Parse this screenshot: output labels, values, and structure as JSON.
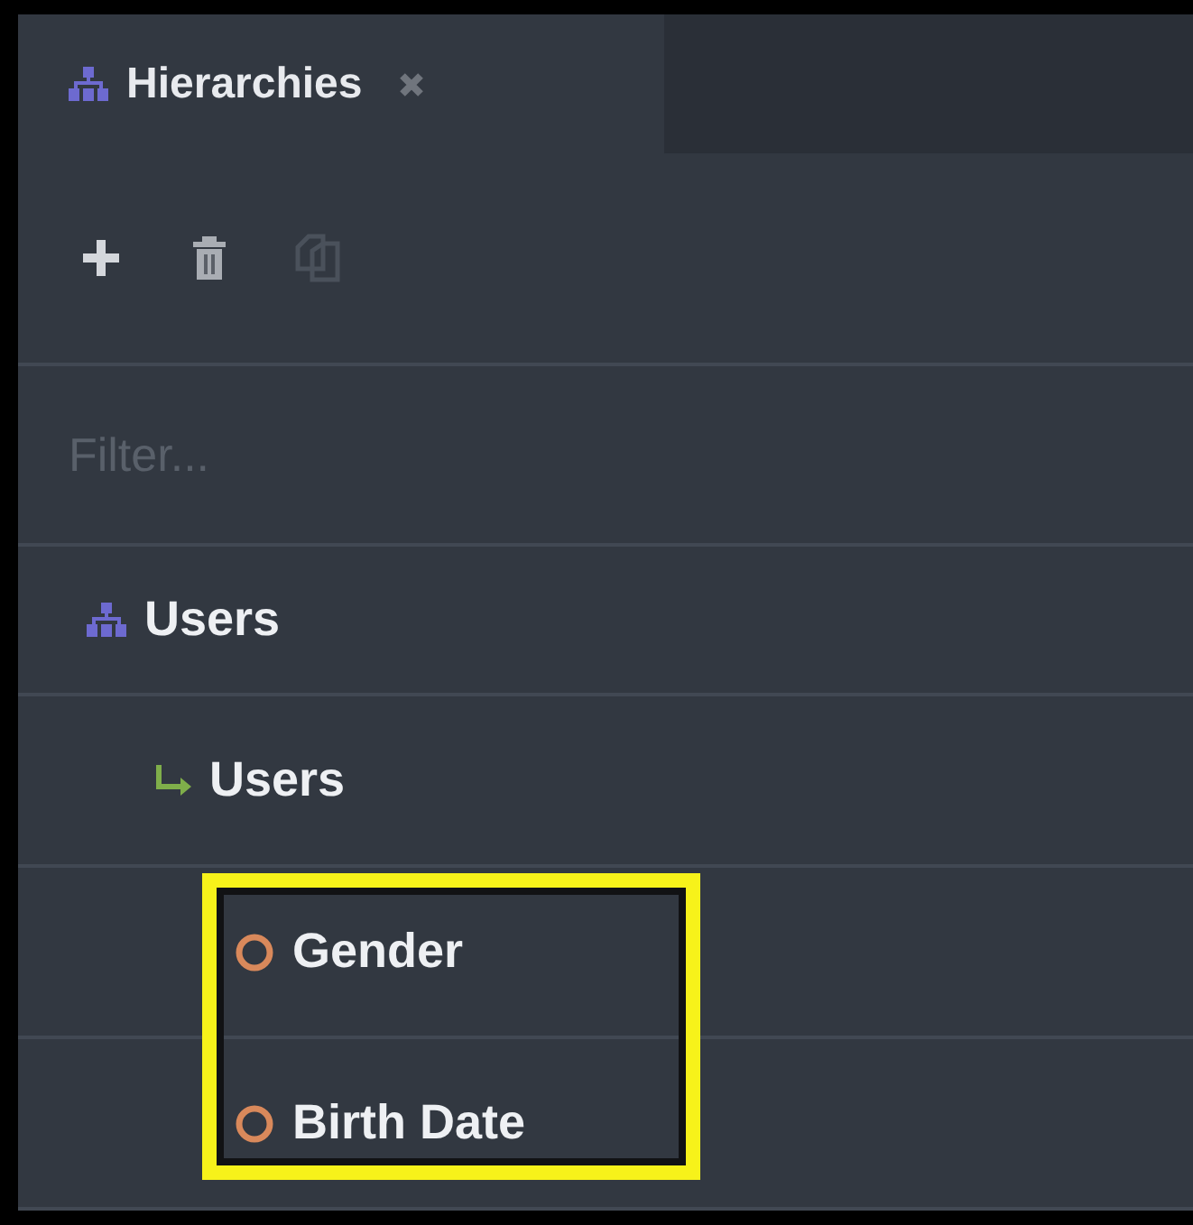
{
  "tabs": [
    {
      "label": "Hierarchies",
      "selected": true
    }
  ],
  "toolbar": [
    {
      "kind": "add",
      "disabled": false
    },
    {
      "kind": "delete",
      "disabled": false
    },
    {
      "kind": "duplicate",
      "disabled": true
    }
  ],
  "filter": {
    "placeholder": "Filter..."
  },
  "tree": [
    {
      "kind": "hierarchy",
      "label": "Users",
      "children": [
        {
          "kind": "level",
          "label": "Users",
          "children": [
            {
              "kind": "attribute",
              "label": "Gender",
              "highlighted": true
            },
            {
              "kind": "attribute",
              "label": "Birth Date",
              "highlighted": true
            }
          ]
        }
      ]
    }
  ]
}
